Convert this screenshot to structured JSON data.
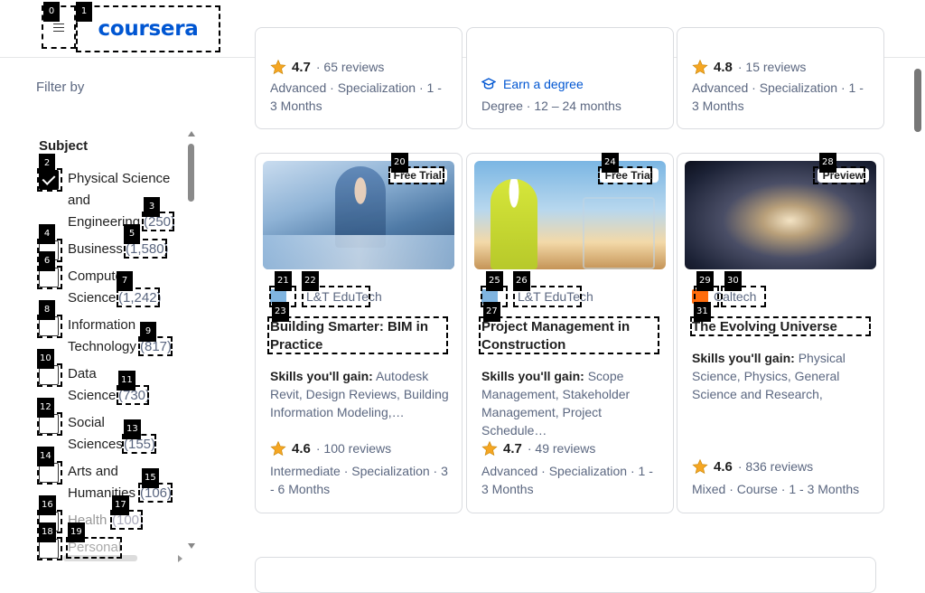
{
  "header": {
    "logo_text": "coursera"
  },
  "sidebar": {
    "filter_by": "Filter by",
    "subject_title": "Subject",
    "items": [
      {
        "label_lines": [
          "Physical Science",
          "and",
          "Engineering"
        ],
        "count": "(250)",
        "checked": true
      },
      {
        "label_lines": [
          "Business"
        ],
        "count": "(1,580)",
        "checked": false
      },
      {
        "label_lines": [
          "Computer",
          "Science"
        ],
        "count": "(1,242)",
        "checked": false
      },
      {
        "label_lines": [
          "Information",
          "Technology"
        ],
        "count": "(817)",
        "checked": false
      },
      {
        "label_lines": [
          "Data",
          "Science"
        ],
        "count": "(730)",
        "checked": false
      },
      {
        "label_lines": [
          "Social",
          "Sciences"
        ],
        "count": "(155)",
        "checked": false
      },
      {
        "label_lines": [
          "Arts and",
          "Humanities"
        ],
        "count": "(106)",
        "checked": false
      },
      {
        "label_lines": [
          "Health"
        ],
        "count": "(100)",
        "checked": false
      },
      {
        "label_lines": [
          "Personal"
        ],
        "count": "",
        "checked": false
      }
    ]
  },
  "top_cards": [
    {
      "rating": "4.7",
      "reviews": "65 reviews",
      "meta": "Advanced · Specialization · 1 - 3 Months"
    },
    {
      "degree_link": "Earn a degree",
      "meta": "Degree · 12 – 24 months"
    },
    {
      "rating": "4.8",
      "reviews": "15 reviews",
      "meta": "Advanced · Specialization · 1 - 3 Months"
    }
  ],
  "cards": [
    {
      "badge": "Free Trial",
      "partner": "L&T EduTech",
      "title": "Building Smarter: BIM in Practice",
      "skills_label": "Skills you'll gain:",
      "skills": "Autodesk Revit, Design Reviews, Building Information Modeling,…",
      "rating": "4.6",
      "reviews": "100 reviews",
      "meta": "Intermediate · Specialization · 3 - 6 Months"
    },
    {
      "badge": "Free Trial",
      "partner": "L&T EduTech",
      "title": "Project Management in Construction",
      "skills_label": "Skills you'll gain:",
      "skills": "Scope Management, Stakeholder Management, Project Schedule…",
      "rating": "4.7",
      "reviews": "49 reviews",
      "meta": "Advanced · Specialization · 1 - 3 Months"
    },
    {
      "badge": "Preview",
      "partner": "Caltech",
      "title": "The Evolving Universe",
      "skills_label": "Skills you'll gain:",
      "skills": "Physical Science, Physics, General Science and Research, Mechanics, Spati…",
      "rating": "4.6",
      "reviews": "836 reviews",
      "meta": "Mixed · Course · 1 - 3 Months"
    }
  ],
  "tags": [
    "0",
    "1",
    "2",
    "3",
    "4",
    "5",
    "6",
    "7",
    "8",
    "9",
    "10",
    "11",
    "12",
    "13",
    "14",
    "15",
    "16",
    "17",
    "18",
    "19",
    "20",
    "21",
    "22",
    "23",
    "24",
    "25",
    "26",
    "27",
    "28",
    "29",
    "30",
    "31"
  ],
  "colors": {
    "brand": "#0056d2",
    "star": "#f5a623",
    "muted": "#5b6780"
  }
}
